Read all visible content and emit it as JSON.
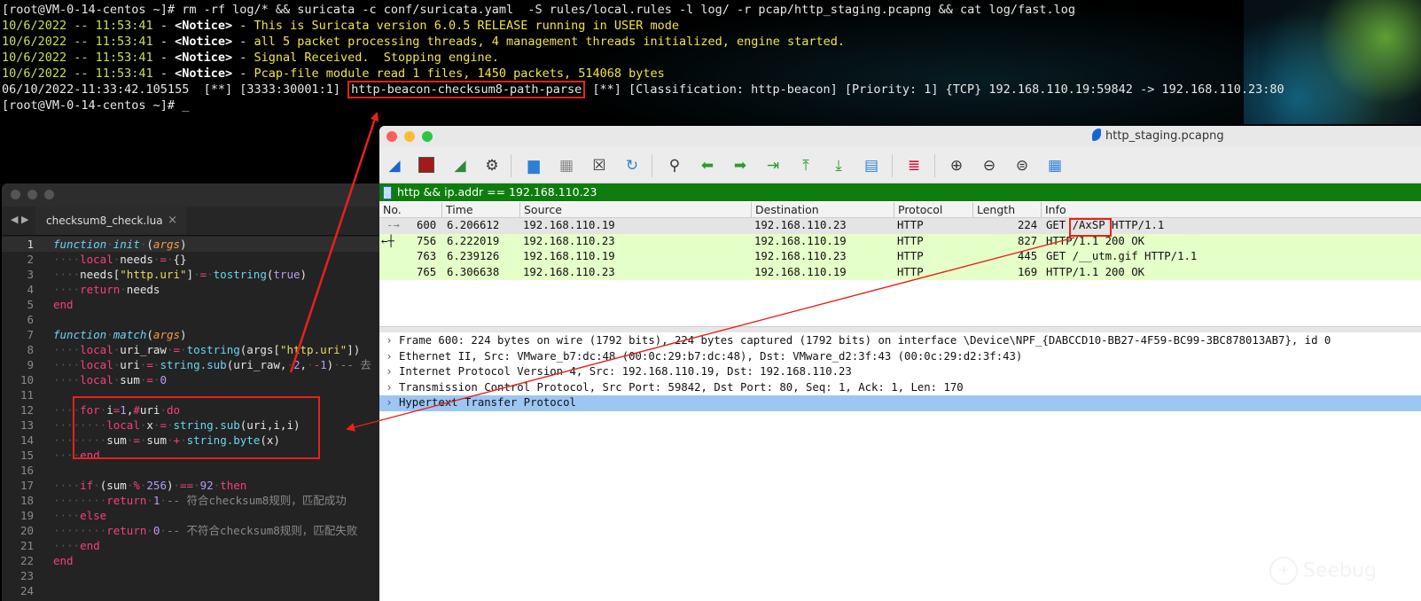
{
  "terminal": {
    "prompt": "[root@VM-0-14-centos ~]#",
    "command": " rm -rf log/* && suricata -c conf/suricata.yaml  -S rules/local.rules -l log/ -r pcap/http_staging.pcapng && cat log/fast.log",
    "log_lines": [
      {
        "ts": "10/6/2022 -- 11:53:41",
        "level": "<Notice>",
        "msg": "This is Suricata version 6.0.5 RELEASE running in USER mode"
      },
      {
        "ts": "10/6/2022 -- 11:53:41",
        "level": "<Notice>",
        "msg": "all 5 packet processing threads, 4 management threads initialized, engine started."
      },
      {
        "ts": "10/6/2022 -- 11:53:41",
        "level": "<Notice>",
        "msg": "Signal Received.  Stopping engine."
      },
      {
        "ts": "10/6/2022 -- 11:53:41",
        "level": "<Notice>",
        "msg": "Pcap-file module read 1 files, 1450 packets, 514068 bytes"
      }
    ],
    "alert": {
      "prefix": "06/10/2022-11:33:42.105155  [**] [3333:30001:1] ",
      "rule": "http-beacon-checksum8-path-parse",
      "suffix": " [**] [Classification: http-beacon] [Priority: 1] {TCP} 192.168.110.19:59842 -> 192.168.110.23:80"
    },
    "cursor": "_"
  },
  "editor": {
    "tab_label": "checksum8_check.lua",
    "tab_close": "×",
    "nav": "◀ ▶",
    "line_numbers": [
      "1",
      "2",
      "3",
      "4",
      "5",
      "6",
      "7",
      "8",
      "9",
      "10",
      "11",
      "12",
      "13",
      "14",
      "15",
      "16",
      "17",
      "18",
      "19",
      "20",
      "21",
      "22",
      "23",
      "24"
    ],
    "comments": {
      "l9": "-- 去",
      "l18": "-- 符合checksum8规则，匹配成功",
      "l20": "-- 不符合checksum8规则，匹配失败"
    }
  },
  "wireshark": {
    "title": "http_staging.pcapng",
    "filter": "http && ip.addr == 192.168.110.23",
    "columns": [
      "No.",
      "Time",
      "Source",
      "Destination",
      "Protocol",
      "Length",
      "Info"
    ],
    "packets": [
      {
        "no": "600",
        "time": "6.206612",
        "src": "192.168.110.19",
        "dst": "192.168.110.23",
        "proto": "HTTP",
        "len": "224",
        "info_pre": "GET ",
        "info_hl": "/AxSP",
        "info_post": " HTTP/1.1"
      },
      {
        "no": "756",
        "time": "6.222019",
        "src": "192.168.110.23",
        "dst": "192.168.110.19",
        "proto": "HTTP",
        "len": "827",
        "info_pre": "HTTP/1.1 200 OK",
        "info_hl": "",
        "info_post": ""
      },
      {
        "no": "763",
        "time": "6.239126",
        "src": "192.168.110.19",
        "dst": "192.168.110.23",
        "proto": "HTTP",
        "len": "445",
        "info_pre": "GET /__utm.gif HTTP/1.1",
        "info_hl": "",
        "info_post": ""
      },
      {
        "no": "765",
        "time": "6.306638",
        "src": "192.168.110.23",
        "dst": "192.168.110.19",
        "proto": "HTTP",
        "len": "169",
        "info_pre": "HTTP/1.1 200 OK",
        "info_hl": "",
        "info_post": ""
      }
    ],
    "details": [
      "Frame 600: 224 bytes on wire (1792 bits), 224 bytes captured (1792 bits) on interface \\Device\\NPF_{DABCCD10-BB27-4F59-BC99-3BC878013AB7}, id 0",
      "Ethernet II, Src: VMware_b7:dc:48 (00:0c:29:b7:dc:48), Dst: VMware_d2:3f:43 (00:0c:29:d2:3f:43)",
      "Internet Protocol Version 4, Src: 192.168.110.19, Dst: 192.168.110.23",
      "Transmission Control Protocol, Src Port: 59842, Dst Port: 80, Seq: 1, Ack: 1, Len: 170",
      "Hypertext Transfer Protocol"
    ],
    "colors": {
      "row_selected": "#e4e4e4",
      "row_http": "#e4ffc7",
      "detail_selected": "#9cc7f5",
      "filter_ok": "#0e7d0e"
    }
  },
  "watermark": {
    "text": "Seebug",
    "icon": "seebug-logo-icon"
  },
  "annotation_color": "#e8211d"
}
